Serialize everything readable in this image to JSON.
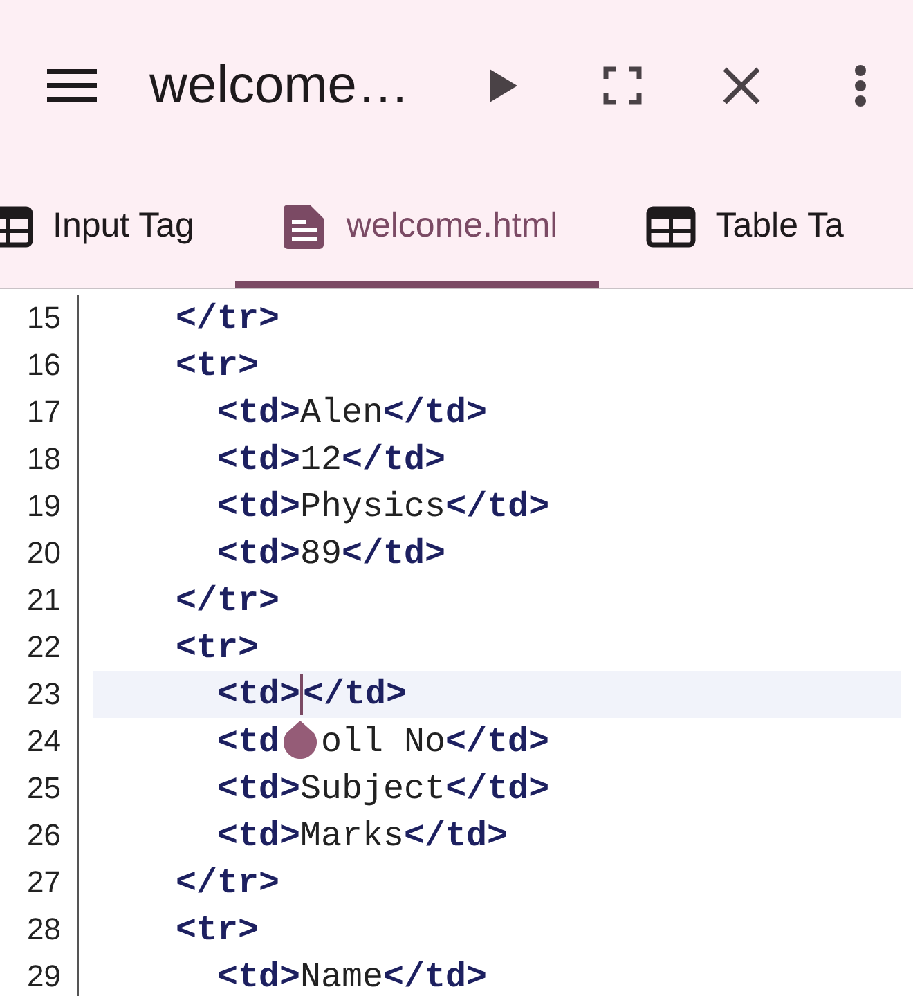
{
  "toolbar": {
    "title": "welcome…"
  },
  "tabs": [
    {
      "label": "Input Tag",
      "kind": "table",
      "selected": false
    },
    {
      "label": "welcome.html",
      "kind": "document",
      "selected": true
    },
    {
      "label": "Table Ta",
      "kind": "table",
      "selected": false
    }
  ],
  "editor": {
    "lines": [
      {
        "number": "15",
        "text": "    </tr>",
        "current": false
      },
      {
        "number": "16",
        "text": "    <tr>",
        "current": false
      },
      {
        "number": "17",
        "text": "      <td>Alen</td>",
        "current": false
      },
      {
        "number": "18",
        "text": "      <td>12</td>",
        "current": false
      },
      {
        "number": "19",
        "text": "      <td>Physics</td>",
        "current": false
      },
      {
        "number": "20",
        "text": "      <td>89</td>",
        "current": false
      },
      {
        "number": "21",
        "text": "    </tr>",
        "current": false
      },
      {
        "number": "22",
        "text": "    <tr>",
        "current": false
      },
      {
        "number": "23",
        "text": "      <td>",
        "text_after_cursor": "</td>",
        "current": true
      },
      {
        "number": "24",
        "text": "      <td",
        "text_after_handle": "oll No</td>",
        "current": false
      },
      {
        "number": "25",
        "text": "      <td>Subject</td>",
        "current": false
      },
      {
        "number": "26",
        "text": "      <td>Marks</td>",
        "current": false
      },
      {
        "number": "27",
        "text": "    </tr>",
        "current": false
      },
      {
        "number": "28",
        "text": "    <tr>",
        "current": false
      },
      {
        "number": "29",
        "text": "      <td>Name</td>",
        "current": false
      }
    ]
  }
}
